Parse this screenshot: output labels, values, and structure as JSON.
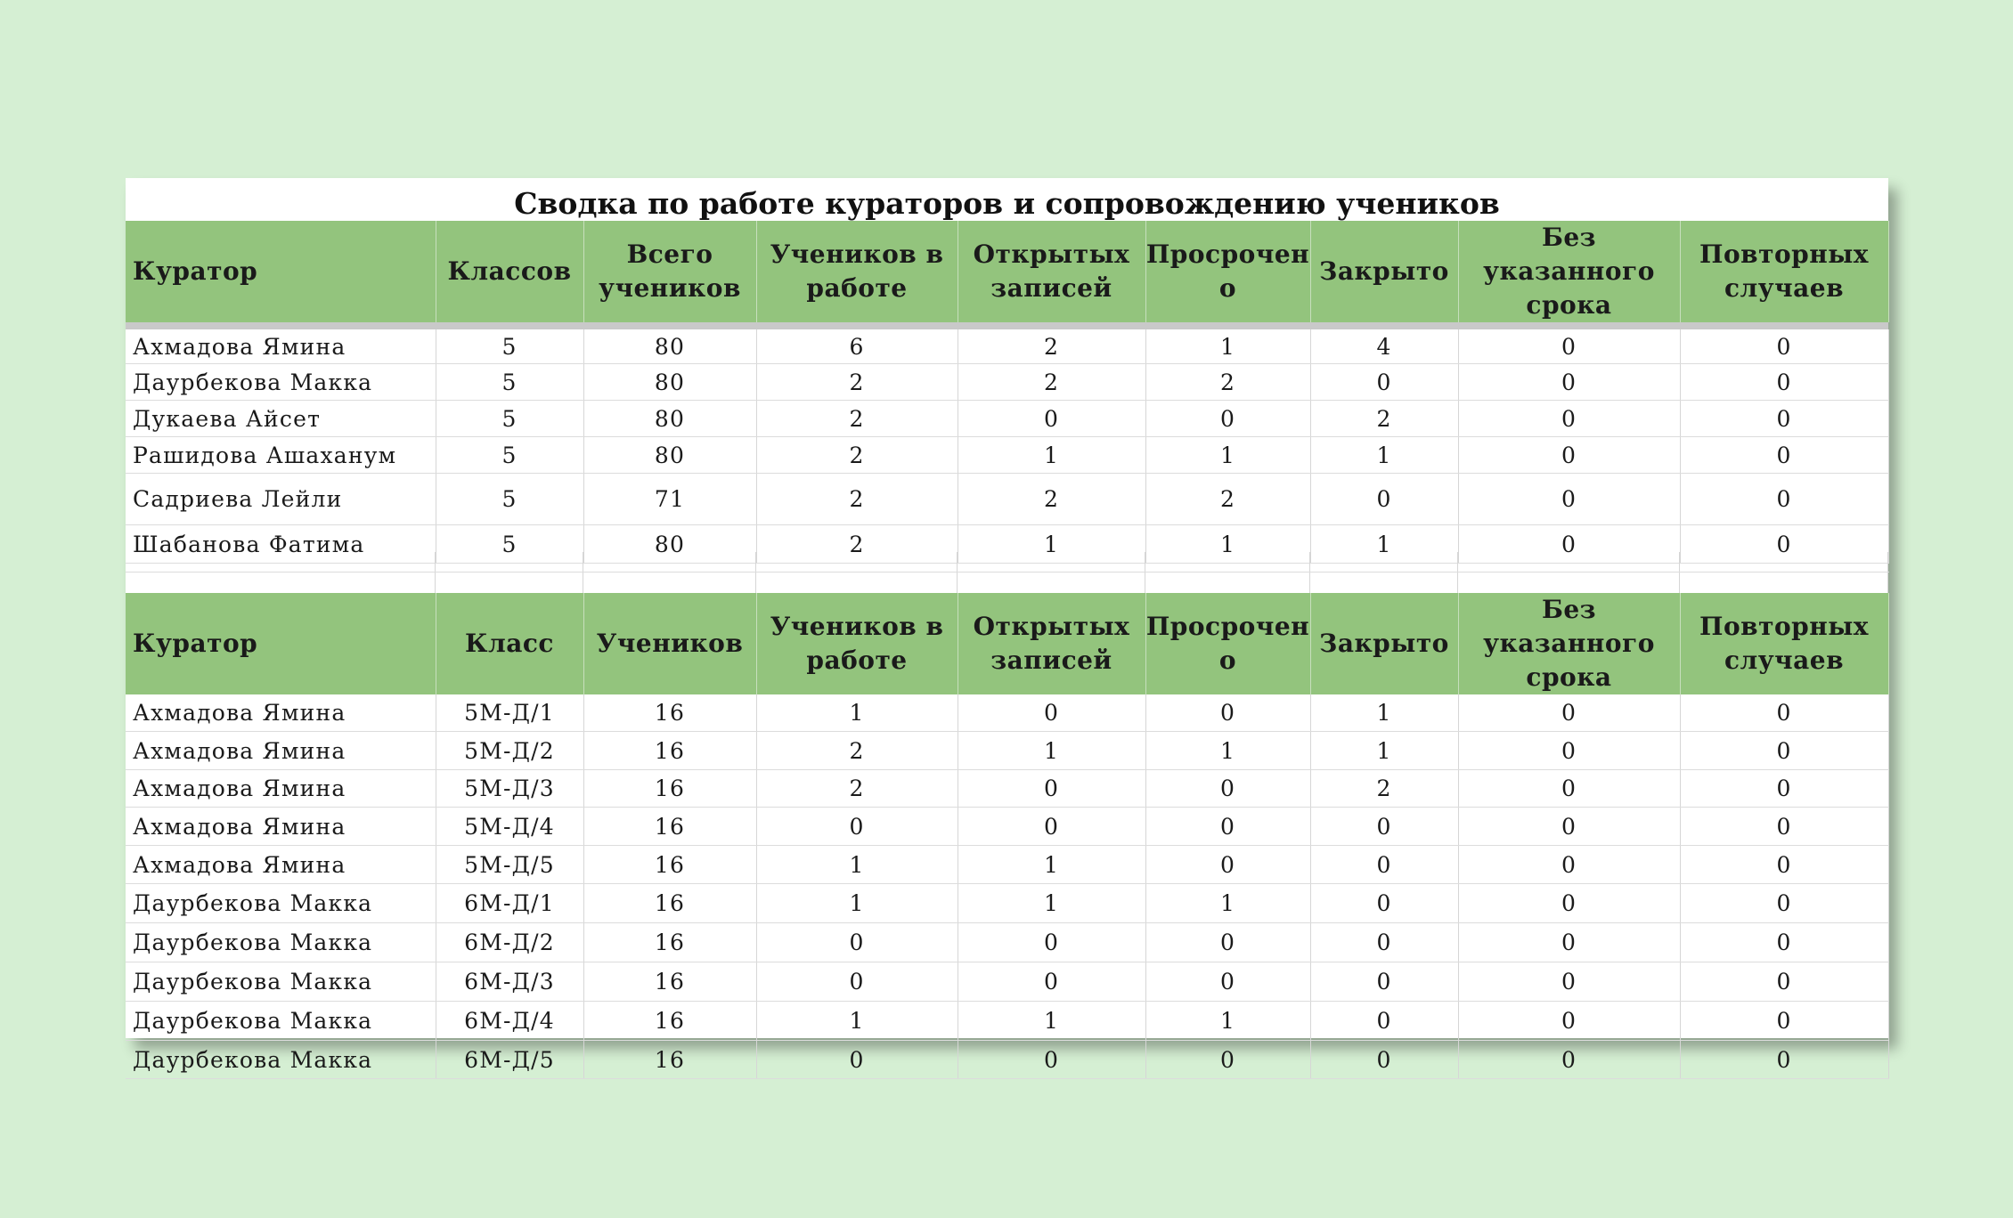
{
  "title": "Сводка по работе кураторов и сопровождению учеников",
  "colors": {
    "background": "#d5efd3",
    "header": "#93c47d"
  },
  "summary_table": {
    "headers": [
      "Куратор",
      "Классов",
      "Всего учеников",
      "Учеников в работе",
      "Открытых записей",
      "Просрочен о",
      "Закрыто",
      "Без указанного срока",
      "Повторных случаев"
    ],
    "rows": [
      [
        "Ахмадова Ямина",
        "5",
        "80",
        "6",
        "2",
        "1",
        "4",
        "0",
        "0"
      ],
      [
        "Даурбекова Макка",
        "5",
        "80",
        "2",
        "2",
        "2",
        "0",
        "0",
        "0"
      ],
      [
        "Дукаева Айсет",
        "5",
        "80",
        "2",
        "0",
        "0",
        "2",
        "0",
        "0"
      ],
      [
        "Рашидова Ашаханум",
        "5",
        "80",
        "2",
        "1",
        "1",
        "1",
        "0",
        "0"
      ],
      [
        "Садриева Лейли",
        "5",
        "71",
        "2",
        "2",
        "2",
        "0",
        "0",
        "0"
      ],
      [
        "Шабанова Фатима",
        "5",
        "80",
        "2",
        "1",
        "1",
        "1",
        "0",
        "0"
      ]
    ]
  },
  "class_table": {
    "headers": [
      "Куратор",
      "Класс",
      "Учеников",
      "Учеников в работе",
      "Открытых записей",
      "Просрочен о",
      "Закрыто",
      "Без указанного срока",
      "Повторных случаев"
    ],
    "rows": [
      [
        "Ахмадова Ямина",
        "5М-Д/1",
        "16",
        "1",
        "0",
        "0",
        "1",
        "0",
        "0"
      ],
      [
        "Ахмадова Ямина",
        "5М-Д/2",
        "16",
        "2",
        "1",
        "1",
        "1",
        "0",
        "0"
      ],
      [
        "Ахмадова Ямина",
        "5М-Д/3",
        "16",
        "2",
        "0",
        "0",
        "2",
        "0",
        "0"
      ],
      [
        "Ахмадова Ямина",
        "5М-Д/4",
        "16",
        "0",
        "0",
        "0",
        "0",
        "0",
        "0"
      ],
      [
        "Ахмадова Ямина",
        "5М-Д/5",
        "16",
        "1",
        "1",
        "0",
        "0",
        "0",
        "0"
      ],
      [
        "Даурбекова Макка",
        "6М-Д/1",
        "16",
        "1",
        "1",
        "1",
        "0",
        "0",
        "0"
      ],
      [
        "Даурбекова Макка",
        "6М-Д/2",
        "16",
        "0",
        "0",
        "0",
        "0",
        "0",
        "0"
      ],
      [
        "Даурбекова Макка",
        "6М-Д/3",
        "16",
        "0",
        "0",
        "0",
        "0",
        "0",
        "0"
      ],
      [
        "Даурбекова Макка",
        "6М-Д/4",
        "16",
        "1",
        "1",
        "1",
        "0",
        "0",
        "0"
      ],
      [
        "Даурбекова Макка",
        "6М-Д/5",
        "16",
        "0",
        "0",
        "0",
        "0",
        "0",
        "0"
      ]
    ]
  }
}
